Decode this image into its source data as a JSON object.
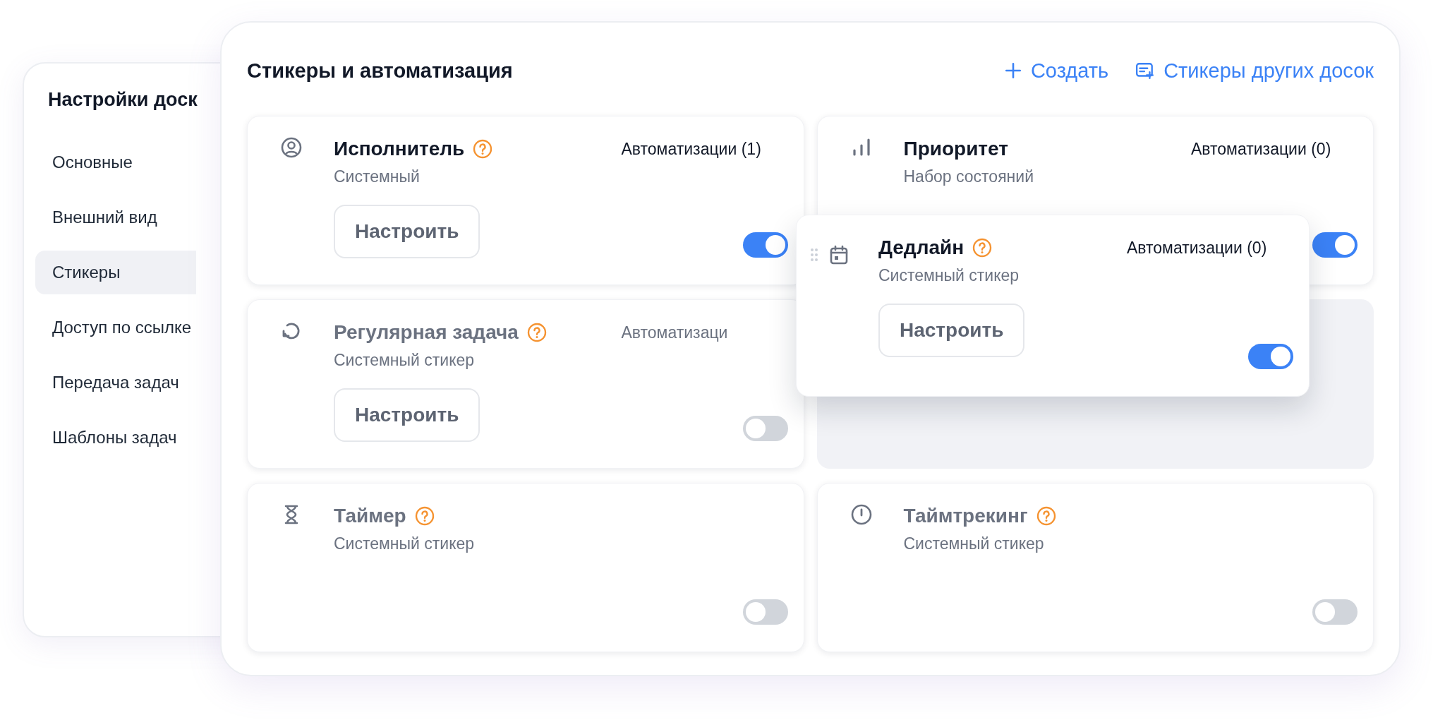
{
  "settings_panel": {
    "title": "Настройки доск",
    "nav": [
      {
        "label": "Основные",
        "selected": false
      },
      {
        "label": "Внешний вид",
        "selected": false
      },
      {
        "label": "Стикеры",
        "selected": true
      },
      {
        "label": "Доступ по ссылке",
        "selected": false
      },
      {
        "label": "Передача задач",
        "selected": false
      },
      {
        "label": "Шаблоны задач",
        "selected": false
      }
    ]
  },
  "main": {
    "title": "Стикеры и автоматизация",
    "actions": [
      {
        "kind": "create",
        "label": "Создать"
      },
      {
        "kind": "boards",
        "label": "Стикеры других досок"
      }
    ],
    "cards": [
      {
        "kind": "sticker",
        "title": "Исполнитель",
        "help": true,
        "subtitle": "Системный",
        "automations": "Автоматизации (1)",
        "button": "Настроить",
        "on": true
      },
      {
        "kind": "sticker",
        "title": "Приоритет",
        "help": false,
        "subtitle": "Набор состояний",
        "automations": "Автоматизации (0)",
        "on": true
      },
      {
        "kind": "sticker",
        "title": "Регулярная задача",
        "help": true,
        "subtitle": "Системный стикер",
        "automations": "Автоматизаци",
        "button": "Настроить",
        "on": false
      },
      {
        "kind": "placeholder"
      },
      {
        "kind": "sticker",
        "title": "Таймер",
        "help": true,
        "subtitle": "Системный стикер",
        "on": false
      },
      {
        "kind": "sticker",
        "title": "Таймтрекинг",
        "help": true,
        "subtitle": "Системный стикер",
        "on": false
      }
    ]
  },
  "dragged_card": {
    "title": "Дедлайн",
    "help": true,
    "subtitle": "Системный стикер",
    "automations": "Автоматизации (0)",
    "button": "Настроить",
    "on": true
  }
}
